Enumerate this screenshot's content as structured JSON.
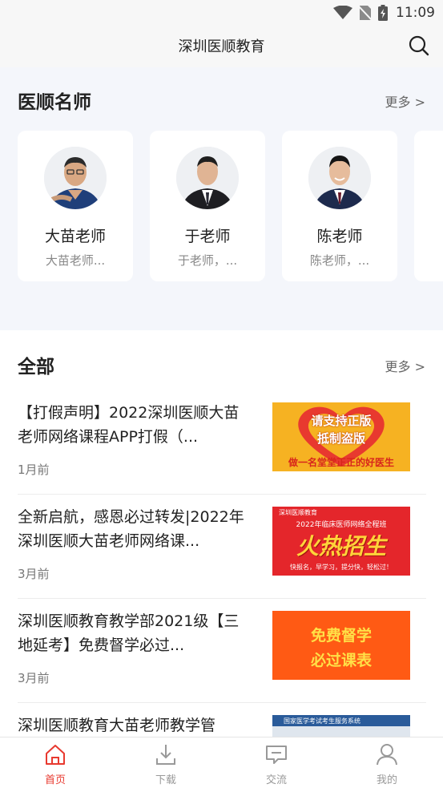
{
  "status_bar": {
    "time": "11:09"
  },
  "header": {
    "title": "深圳医顺教育"
  },
  "teachers_section": {
    "title": "医顺名师",
    "more": "更多 >",
    "teachers": [
      {
        "name": "大苗老师",
        "desc": "大苗老师..."
      },
      {
        "name": "于老师",
        "desc": "于老师，..."
      },
      {
        "name": "陈老师",
        "desc": "陈老师，..."
      }
    ]
  },
  "all_section": {
    "title": "全部",
    "more": "更多 >",
    "articles": [
      {
        "title": "【打假声明】2022深圳医顺大苗老师网络课程APP打假（...",
        "time": "1月前",
        "thumb": {
          "line1": "请支持正版",
          "line2": "抵制盗版",
          "caption": "做一名堂堂正正的好医生"
        }
      },
      {
        "title": "全新启航，感恩必过转发|2022年深圳医顺大苗老师网络课...",
        "time": "3月前",
        "thumb": {
          "brand": "深圳医顺教育",
          "subtitle": "2022年临床医师网络全程班",
          "headline": "火热招生",
          "slogan": "快报名，早学习，提分快，轻松过！"
        }
      },
      {
        "title": "深圳医顺教育教学部2021级【三地延考】免费督学必过...",
        "time": "3月前",
        "thumb": {
          "line1": "免费督学",
          "line2": "必过课表"
        }
      },
      {
        "title": "深圳医顺教育大苗老师教学管",
        "time": "",
        "thumb": {
          "caption": "国家医学考试考生服务系统"
        }
      }
    ]
  },
  "tab_bar": {
    "tabs": [
      {
        "label": "首页",
        "icon": "home-icon",
        "active": true
      },
      {
        "label": "下载",
        "icon": "download-icon",
        "active": false
      },
      {
        "label": "交流",
        "icon": "chat-icon",
        "active": false
      },
      {
        "label": "我的",
        "icon": "user-icon",
        "active": false
      }
    ]
  },
  "colors": {
    "accent": "#e8392f",
    "section_bg": "#f4f6fb",
    "header_bg": "#f7f7f7"
  }
}
